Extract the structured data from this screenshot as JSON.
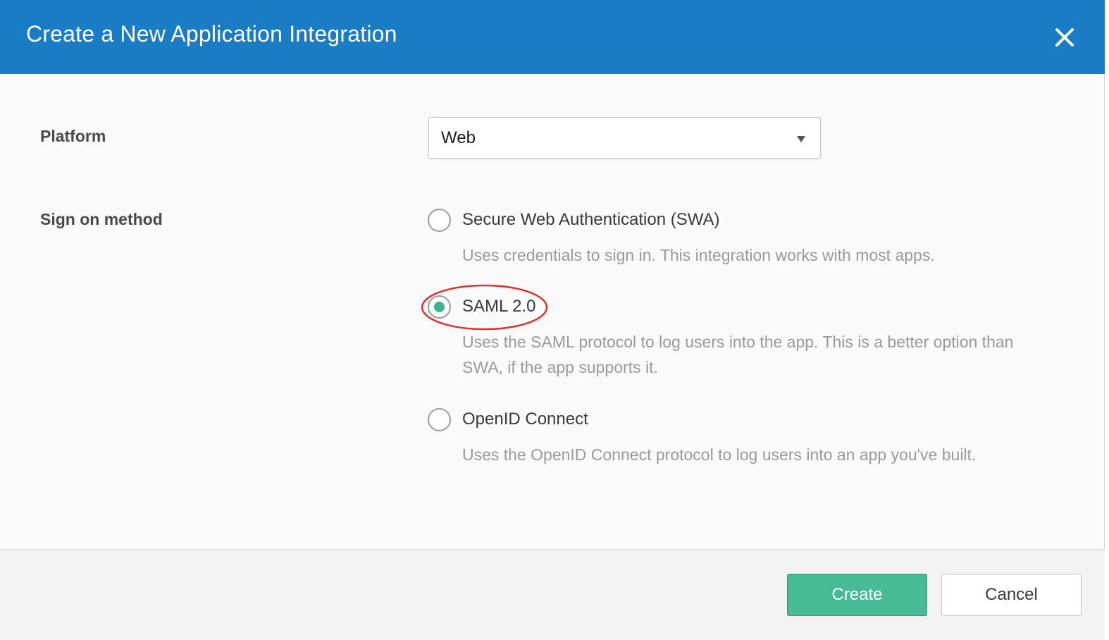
{
  "dialog": {
    "title": "Create a New Application Integration",
    "close_icon": "close-icon"
  },
  "form": {
    "platform": {
      "label": "Platform",
      "selected": "Web"
    },
    "sign_on_method": {
      "label": "Sign on method",
      "options": [
        {
          "label": "Secure Web Authentication (SWA)",
          "description": "Uses credentials to sign in. This integration works with most apps.",
          "checked": false
        },
        {
          "label": "SAML 2.0",
          "description": "Uses the SAML protocol to log users into the app. This is a better option than SWA, if the app supports it.",
          "checked": true
        },
        {
          "label": "OpenID Connect",
          "description": "Uses the OpenID Connect protocol to log users into an app you've built.",
          "checked": false
        }
      ]
    }
  },
  "footer": {
    "create_label": "Create",
    "cancel_label": "Cancel"
  },
  "colors": {
    "header": "#1a7cc5",
    "accent": "#46bb96",
    "highlight": "#d9342b"
  }
}
